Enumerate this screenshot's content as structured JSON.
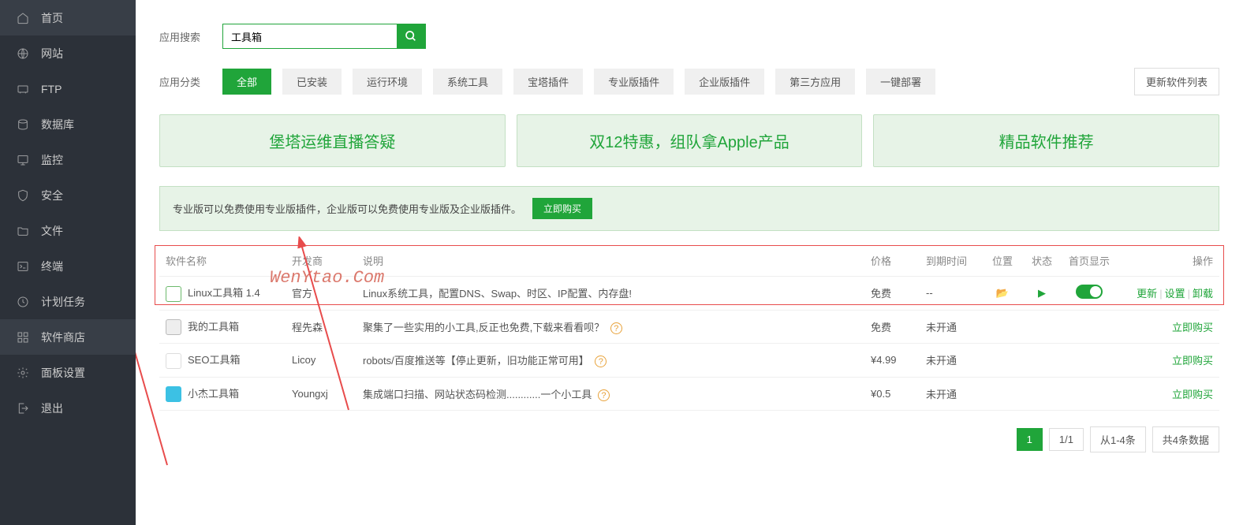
{
  "sidebar": {
    "items": [
      {
        "label": "首页",
        "icon": "home"
      },
      {
        "label": "网站",
        "icon": "globe"
      },
      {
        "label": "FTP",
        "icon": "ftp"
      },
      {
        "label": "数据库",
        "icon": "database"
      },
      {
        "label": "监控",
        "icon": "monitor"
      },
      {
        "label": "安全",
        "icon": "shield"
      },
      {
        "label": "文件",
        "icon": "folder"
      },
      {
        "label": "终端",
        "icon": "terminal"
      },
      {
        "label": "计划任务",
        "icon": "clock"
      },
      {
        "label": "软件商店",
        "icon": "grid",
        "active": true
      },
      {
        "label": "面板设置",
        "icon": "gear"
      },
      {
        "label": "退出",
        "icon": "exit"
      }
    ]
  },
  "search": {
    "label": "应用搜索",
    "value": "工具箱"
  },
  "categories": {
    "label": "应用分类",
    "items": [
      "全部",
      "已安装",
      "运行环境",
      "系统工具",
      "宝塔插件",
      "专业版插件",
      "企业版插件",
      "第三方应用",
      "一键部署"
    ],
    "active_index": 0,
    "update_label": "更新软件列表"
  },
  "banners": [
    "堡塔运维直播答疑",
    "双12特惠，组队拿Apple产品",
    "精品软件推荐"
  ],
  "notice": {
    "text": "专业版可以免费使用专业版插件，企业版可以免费使用专业版及企业版插件。",
    "button": "立即购买"
  },
  "table": {
    "headers": {
      "name": "软件名称",
      "dev": "开发商",
      "desc": "说明",
      "price": "价格",
      "expire": "到期时间",
      "position": "位置",
      "status": "状态",
      "home_display": "首页显示",
      "actions": "操作"
    },
    "rows": [
      {
        "icon_bg": "#fff",
        "icon_border": "#6cb96c",
        "name": "Linux工具箱 1.4",
        "dev": "官方",
        "desc": "Linux系统工具，配置DNS、Swap、时区、IP配置、内存盘!",
        "help": false,
        "price": "免费",
        "price_red": false,
        "expire": "--",
        "position_icon": true,
        "status_icon": true,
        "toggle": true,
        "actions": [
          "更新",
          "设置",
          "卸载"
        ]
      },
      {
        "icon_bg": "#eee",
        "icon_border": "#bbb",
        "name": "我的工具箱",
        "dev": "程先森",
        "desc": "聚集了一些实用的小工具,反正也免费,下载来看看呗？",
        "help": true,
        "price": "免费",
        "price_red": false,
        "expire": "未开通",
        "position_icon": false,
        "status_icon": false,
        "toggle": false,
        "actions": [
          "立即购买"
        ]
      },
      {
        "icon_bg": "#fff",
        "icon_border": "#ddd",
        "name": "SEO工具箱",
        "dev": "Licoy",
        "desc": "robots/百度推送等【停止更新，旧功能正常可用】",
        "help": true,
        "price": "¥4.99",
        "price_red": true,
        "expire": "未开通",
        "position_icon": false,
        "status_icon": false,
        "toggle": false,
        "actions": [
          "立即购买"
        ]
      },
      {
        "icon_bg": "#3cc1e4",
        "icon_border": "#3cc1e4",
        "name": "小杰工具箱",
        "dev": "Youngxj",
        "desc": "集成端口扫描、网站状态码检测............一个小工具",
        "help": true,
        "price": "¥0.5",
        "price_red": true,
        "expire": "未开通",
        "position_icon": false,
        "status_icon": false,
        "toggle": false,
        "actions": [
          "立即购买"
        ]
      }
    ]
  },
  "pagination": {
    "current": "1",
    "pages": "1/1",
    "range": "从1-4条",
    "total": "共4条数据"
  },
  "watermark": "WenYtao.Com"
}
